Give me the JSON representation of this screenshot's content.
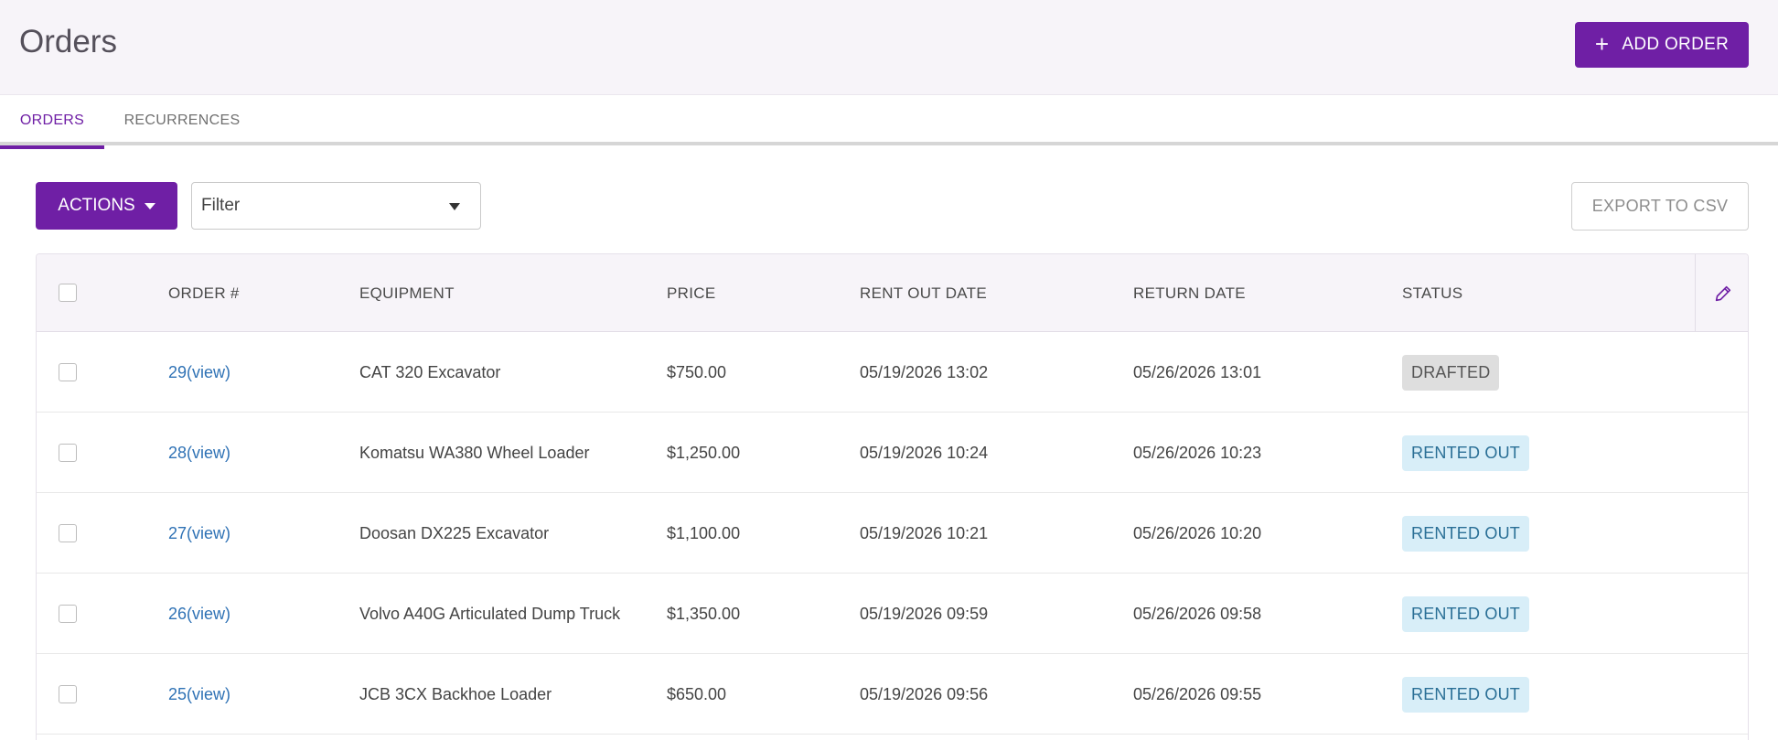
{
  "header": {
    "title": "Orders",
    "add_order_label": "ADD ORDER",
    "add_order_icon": "+"
  },
  "tabs": [
    {
      "label": "ORDERS",
      "active": true
    },
    {
      "label": "RECURRENCES",
      "active": false
    }
  ],
  "toolbar": {
    "actions_label": "ACTIONS",
    "filter_value": "Filter",
    "export_label": "EXPORT TO CSV"
  },
  "table": {
    "columns": [
      "ORDER #",
      "EQUIPMENT",
      "PRICE",
      "RENT OUT DATE",
      "RETURN DATE",
      "STATUS"
    ],
    "rows": [
      {
        "order": "29(view)",
        "equipment": "CAT 320 Excavator",
        "price": "$750.00",
        "rent_out": "05/19/2026 13:02",
        "return": "05/26/2026 13:01",
        "status": "DRAFTED"
      },
      {
        "order": "28(view)",
        "equipment": "Komatsu WA380 Wheel Loader",
        "price": "$1,250.00",
        "rent_out": "05/19/2026 10:24",
        "return": "05/26/2026 10:23",
        "status": "RENTED OUT"
      },
      {
        "order": "27(view)",
        "equipment": "Doosan DX225 Excavator",
        "price": "$1,100.00",
        "rent_out": "05/19/2026 10:21",
        "return": "05/26/2026 10:20",
        "status": "RENTED OUT"
      },
      {
        "order": "26(view)",
        "equipment": "Volvo A40G Articulated Dump Truck",
        "price": "$1,350.00",
        "rent_out": "05/19/2026 09:59",
        "return": "05/26/2026 09:58",
        "status": "RENTED OUT"
      },
      {
        "order": "25(view)",
        "equipment": "JCB 3CX Backhoe Loader",
        "price": "$650.00",
        "rent_out": "05/19/2026 09:56",
        "return": "05/26/2026 09:55",
        "status": "RENTED OUT"
      }
    ]
  },
  "colors": {
    "accent": "#6f1fa5",
    "link": "#2f72b5",
    "drafted_bg": "#dedede",
    "rented_bg": "#d8eef8"
  }
}
